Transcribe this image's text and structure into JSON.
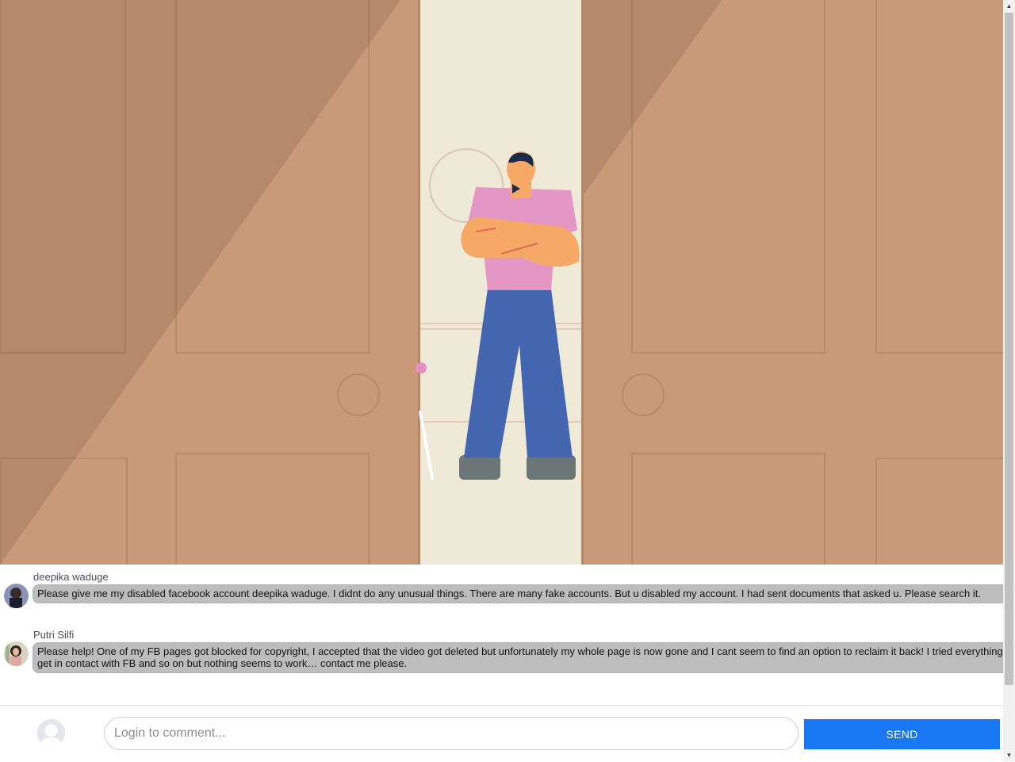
{
  "video": {
    "icon": "video-illustration"
  },
  "comments": [
    {
      "author": "deepika waduge",
      "text": "Please give me my disabled facebook account deepika waduge. I didnt do any unusual things. There are many fake accounts. But u disabled my account. I had sent documents that asked u. Please search it."
    },
    {
      "author": "Putri Silfi",
      "text": "Please help! One of my FB pages got blocked for copyright, I accepted that the video got deleted but unfortunately my whole page is now gone and I cant seem to find an option to reclaim it back! I tried everything to get in contact with FB and so on but nothing seems to work… contact me please."
    }
  ],
  "composer": {
    "placeholder": "Login to comment...",
    "send_label": "SEND"
  },
  "colors": {
    "send_button": "#1877f2",
    "bubble": "#bdbdbd",
    "door": "#c89a78",
    "doorway": "#efe9d8"
  }
}
